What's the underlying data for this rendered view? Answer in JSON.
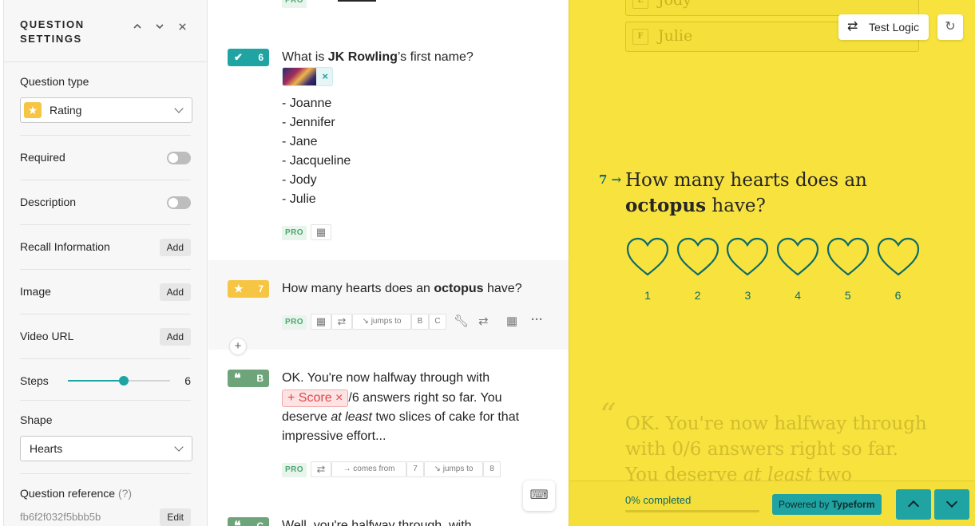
{
  "settings": {
    "title": "QUESTION SETTINGS",
    "question_type_label": "Question type",
    "question_type_value": "Rating",
    "required_label": "Required",
    "description_label": "Description",
    "recall_label": "Recall Information",
    "image_label": "Image",
    "video_label": "Video URL",
    "add_label": "Add",
    "steps_label": "Steps",
    "steps_value": "6",
    "steps_level": 0.55,
    "shape_label": "Shape",
    "shape_value": "Hearts",
    "qref_label": "Question reference",
    "qref_hint": "(?)",
    "qref_value": "fb6f2f032f5bbb5b",
    "edit_label": "Edit"
  },
  "list": {
    "q6": {
      "number": "6",
      "text_before": "What is ",
      "text_bold": "JK Rowling",
      "text_after": "’s first name?",
      "choices": [
        "- Joanne",
        "- Jennifer",
        "- Jane",
        "- Jacqueline",
        "- Jody",
        "- Julie"
      ],
      "pro": "PRO"
    },
    "q7": {
      "number": "7",
      "text_before": "How many hearts does an ",
      "text_bold": "octopus",
      "text_after": " have?",
      "pro": "PRO",
      "jumps_to": "jumps to",
      "target_b": "B",
      "target_c": "C"
    },
    "qb": {
      "number": "B",
      "line1": "OK. You're now halfway through with",
      "score_label": "Score",
      "line2_after": "/6 answers right so far. You",
      "line3_before": "deserve ",
      "line3_italic": "at least",
      "line3_after": " two slices of cake for that",
      "line4": "impressive effort...",
      "pro": "PRO",
      "comes_from": "comes from",
      "from_num": "7",
      "jumps_to": "jumps to",
      "to_num": "8"
    },
    "qc": {
      "number": "C",
      "text": "Well, you're halfway through, with"
    }
  },
  "preview": {
    "choice_e_key": "E",
    "choice_e": "Jody",
    "choice_f_key": "F",
    "choice_f": "Julie",
    "test_logic_label": "Test Logic",
    "qnum": "7",
    "question_before": "How many hearts does an ",
    "question_bold": "octopus",
    "question_after": " have?",
    "ratings": [
      "1",
      "2",
      "3",
      "4",
      "5",
      "6"
    ],
    "statement_before": "OK. You're now halfway through with 0/6 answers right so far. You deserve ",
    "statement_italic": "at least",
    "statement_after": " two",
    "progress_label": "0% completed",
    "progress_level": 0,
    "powered_by": "Powered by",
    "brand": "Typeform"
  },
  "colors": {
    "accent": "#20a3a3",
    "preview_bg": "#f7e23e",
    "rating_badge": "#f6c544",
    "statement_badge": "#6ea47a"
  }
}
